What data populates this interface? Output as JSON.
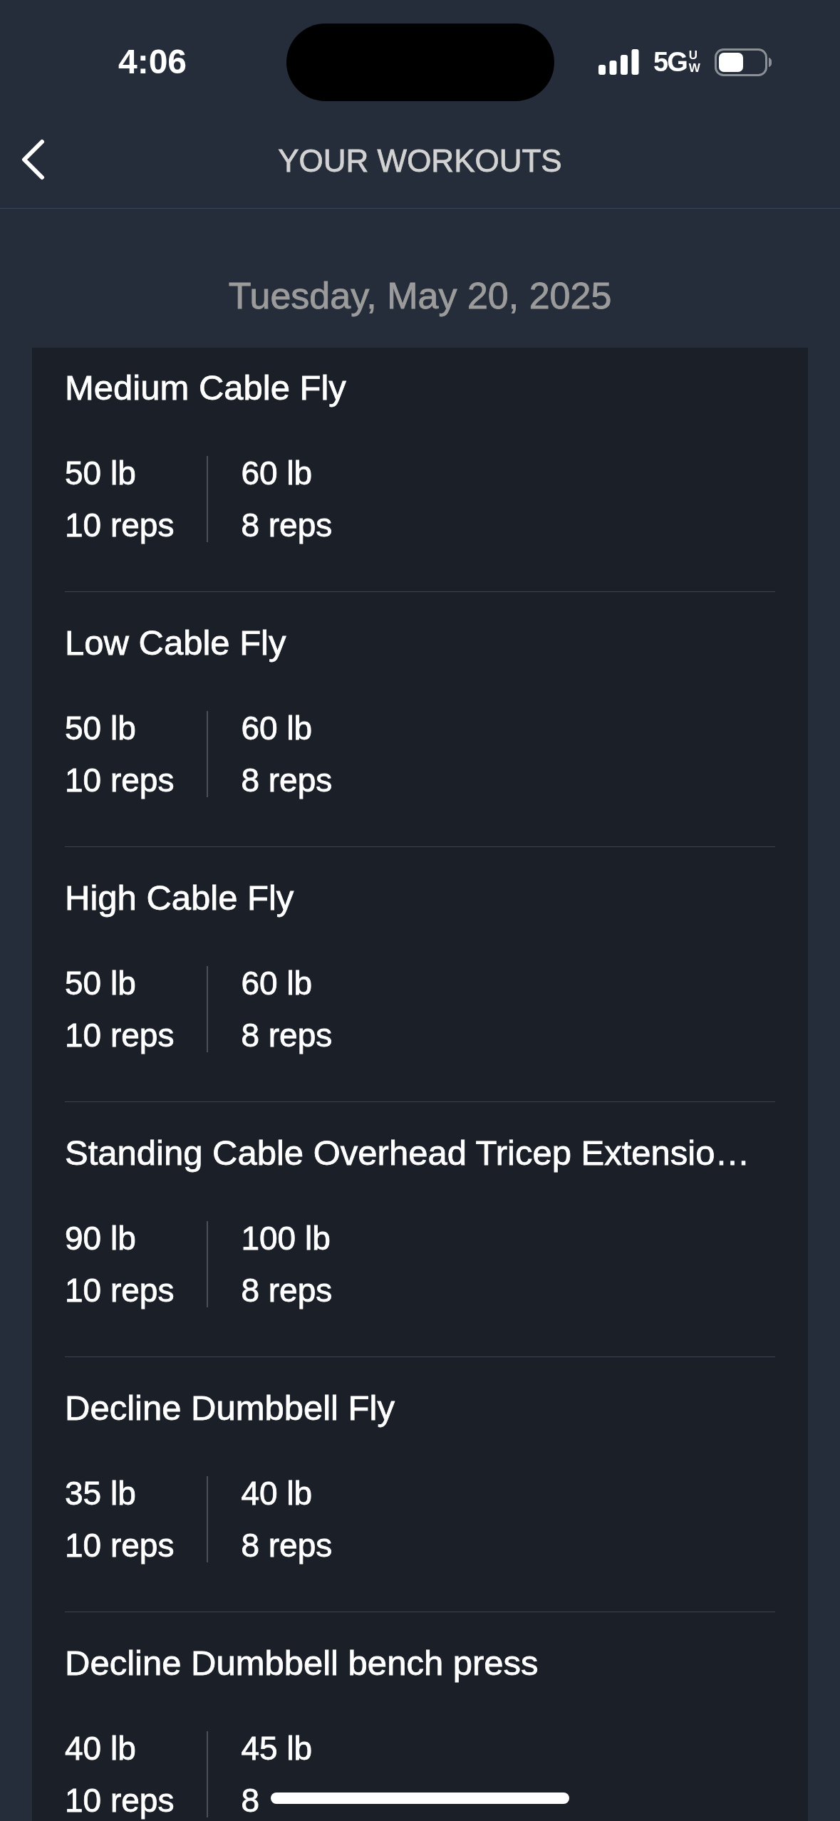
{
  "status_bar": {
    "time": "4:06",
    "network": "5G",
    "network_band": "UW"
  },
  "header": {
    "title": "YOUR WORKOUTS"
  },
  "date": "Tuesday, May 20, 2025",
  "exercises": [
    {
      "name": "Medium Cable Fly",
      "sets": [
        {
          "weight": "50 lb",
          "reps": "10 reps"
        },
        {
          "weight": "60 lb",
          "reps": "8 reps"
        }
      ]
    },
    {
      "name": "Low Cable Fly",
      "sets": [
        {
          "weight": "50 lb",
          "reps": "10 reps"
        },
        {
          "weight": "60 lb",
          "reps": "8 reps"
        }
      ]
    },
    {
      "name": "High Cable Fly",
      "sets": [
        {
          "weight": "50 lb",
          "reps": "10 reps"
        },
        {
          "weight": "60 lb",
          "reps": "8 reps"
        }
      ]
    },
    {
      "name": "Standing Cable Overhead Tricep Extensio…",
      "sets": [
        {
          "weight": "90 lb",
          "reps": "10 reps"
        },
        {
          "weight": "100 lb",
          "reps": "8 reps"
        }
      ]
    },
    {
      "name": "Decline Dumbbell Fly",
      "sets": [
        {
          "weight": "35 lb",
          "reps": "10 reps"
        },
        {
          "weight": "40 lb",
          "reps": "8 reps"
        }
      ]
    },
    {
      "name": "Decline Dumbbell bench press",
      "sets": [
        {
          "weight": "40 lb",
          "reps": "10 reps"
        },
        {
          "weight": "45 lb",
          "reps": "8"
        }
      ]
    }
  ]
}
